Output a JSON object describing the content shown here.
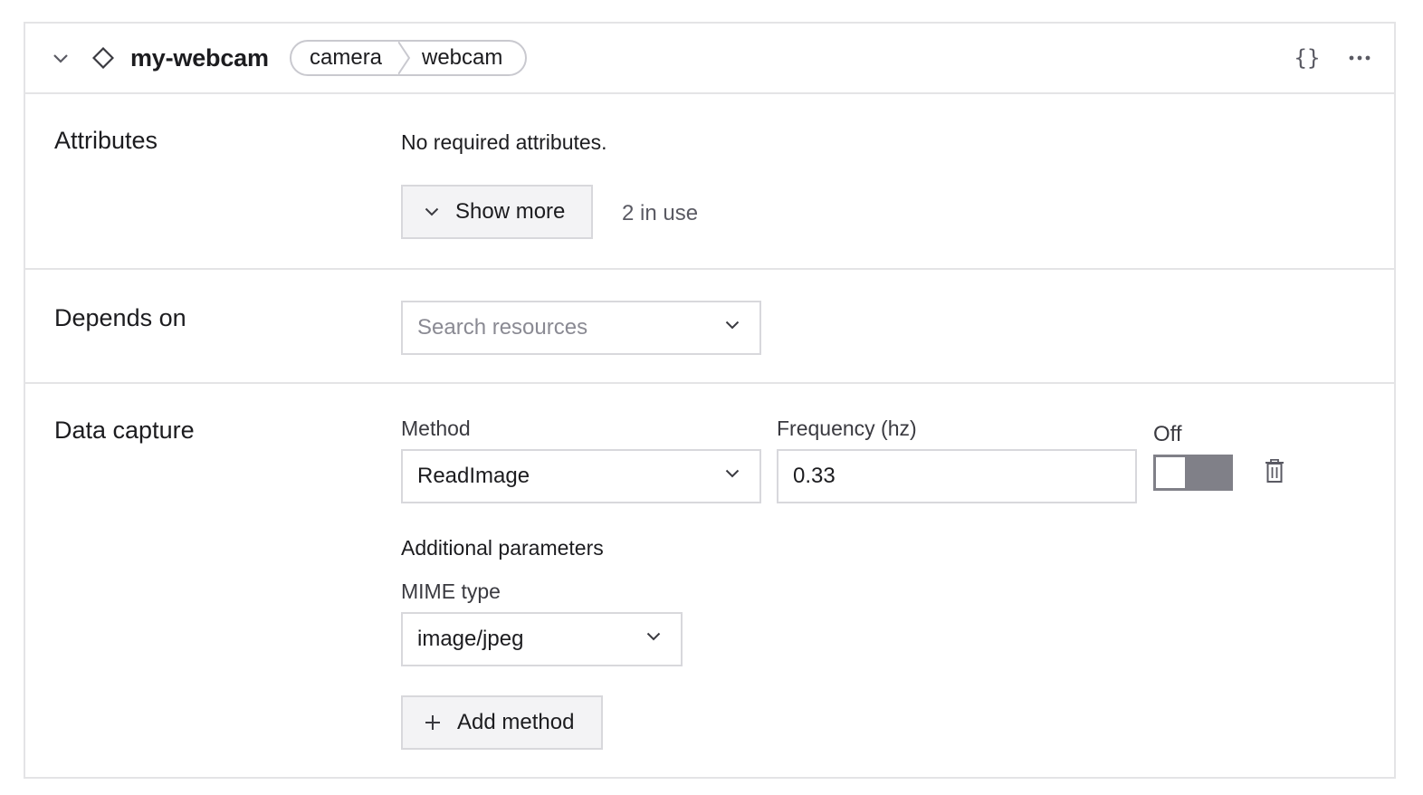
{
  "component": {
    "name": "my-webcam",
    "breadcrumb": [
      "camera",
      "webcam"
    ]
  },
  "header": {
    "json_label": "{}"
  },
  "attributes": {
    "title": "Attributes",
    "message": "No required attributes.",
    "show_more_label": "Show more",
    "in_use": "2 in use"
  },
  "depends_on": {
    "title": "Depends on",
    "placeholder": "Search resources"
  },
  "data_capture": {
    "title": "Data capture",
    "method_label": "Method",
    "method_value": "ReadImage",
    "frequency_label": "Frequency (hz)",
    "frequency_value": "0.33",
    "toggle_label": "Off",
    "toggle_on": false,
    "additional_params_label": "Additional parameters",
    "mime_label": "MIME type",
    "mime_value": "image/jpeg",
    "add_method_label": "Add method"
  }
}
